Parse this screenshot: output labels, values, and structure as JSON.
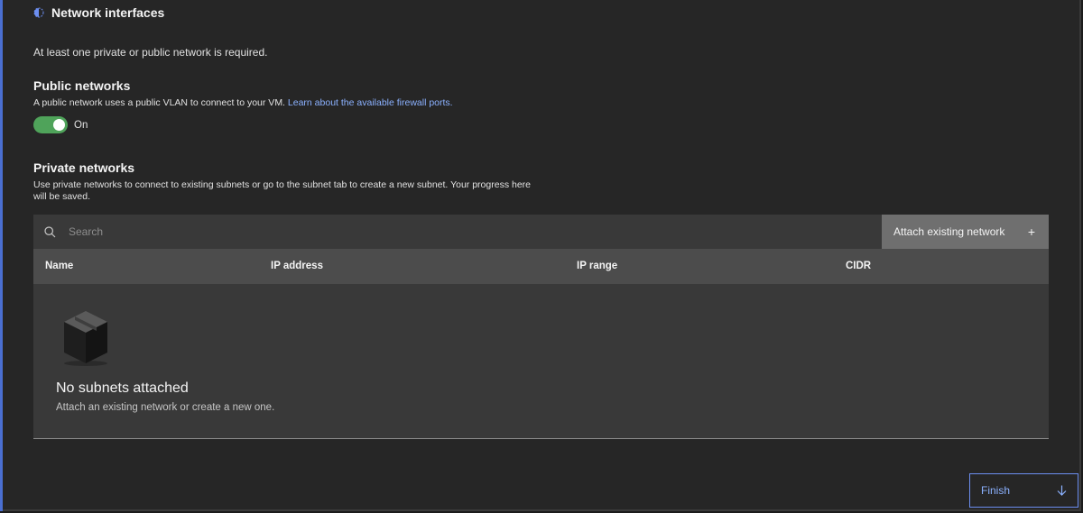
{
  "section": {
    "title": "Network interfaces",
    "requirement": "At least one private or public network is required."
  },
  "public_networks": {
    "title": "Public networks",
    "description": "A public network uses a public VLAN to connect to your VM. ",
    "link_text": "Learn about the available firewall ports.",
    "toggle_label": "On",
    "toggle_on": true
  },
  "private_networks": {
    "title": "Private networks",
    "description": "Use private networks to connect to existing subnets or go to the subnet tab to create a new subnet. Your progress here will be saved."
  },
  "table": {
    "search_placeholder": "Search",
    "attach_label": "Attach existing network",
    "attach_icon": "+",
    "columns": [
      "Name",
      "IP address",
      "IP range",
      "CIDR"
    ],
    "empty_title": "No subnets attached",
    "empty_description": "Attach an existing network or create a new one."
  },
  "footer": {
    "finish_label": "Finish"
  },
  "colors": {
    "accent_blue": "#8bb1ff",
    "toggle_green": "#4fa35a",
    "rail_blue": "#4a6fd1"
  },
  "icons": {
    "section": "half-circle-icon",
    "search": "search-icon",
    "attach": "plus-icon",
    "empty": "box-icon",
    "finish": "arrow-down-icon"
  }
}
